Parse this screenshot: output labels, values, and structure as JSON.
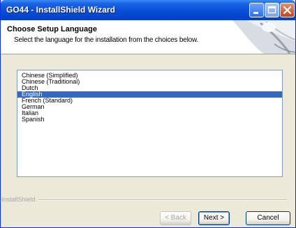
{
  "window": {
    "title": "GO44 - InstallShield Wizard",
    "colors": {
      "titlebar": "#0a4fd8",
      "selection": "#316ac5",
      "face": "#ece9d8"
    }
  },
  "header": {
    "title": "Choose Setup Language",
    "subtitle": "Select the language for the installation from the choices below."
  },
  "languages": [
    {
      "label": "Chinese (Simplified)"
    },
    {
      "label": "Chinese (Traditional)"
    },
    {
      "label": "Dutch"
    },
    {
      "label": "English",
      "selected": true
    },
    {
      "label": "French (Standard)"
    },
    {
      "label": "German"
    },
    {
      "label": "Italian"
    },
    {
      "label": "Spanish"
    }
  ],
  "brand": "InstallShield",
  "buttons": {
    "back": "< Back",
    "next": "Next >",
    "cancel": "Cancel"
  },
  "icons": {
    "minimize": "minimize-icon",
    "maximize": "maximize-icon",
    "close": "close-icon"
  }
}
